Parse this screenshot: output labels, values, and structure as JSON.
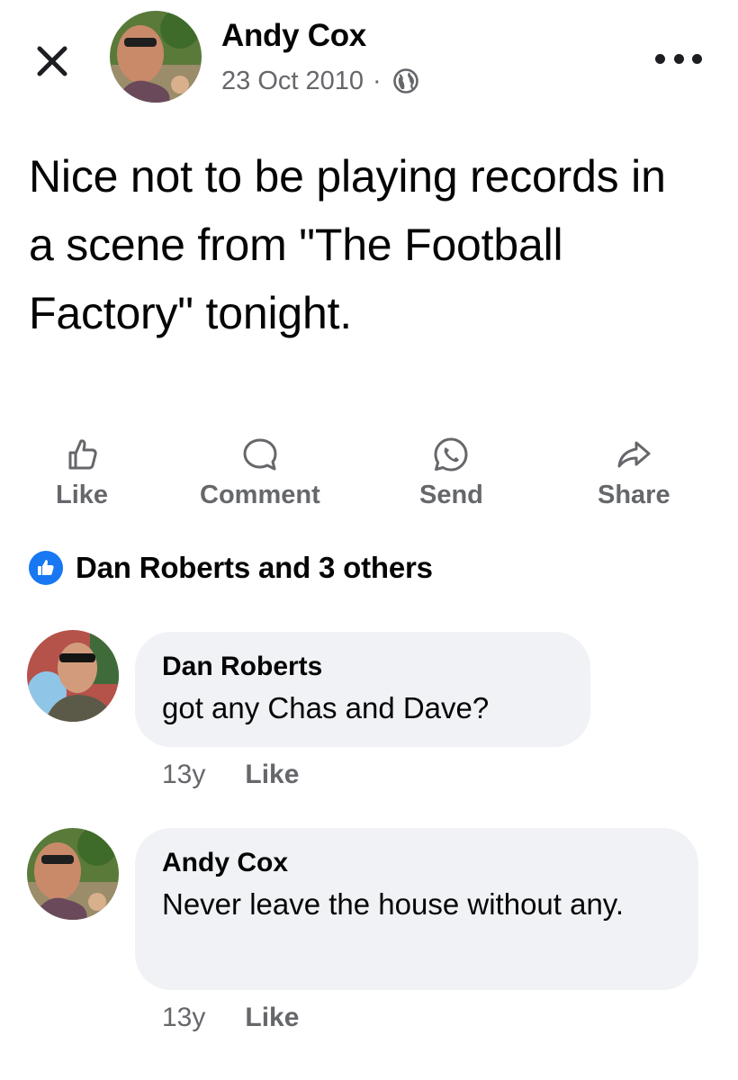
{
  "post": {
    "author": "Andy Cox",
    "date": "23 Oct 2010",
    "separator": "·",
    "audience_icon": "globe-icon",
    "text": "Nice not to be playing records in a scene from \"The Football Factory\" tonight."
  },
  "header": {
    "close_icon": "close-icon",
    "more_icon": "more-options-icon"
  },
  "actions": [
    {
      "label": "Like",
      "icon": "thumbs-up-icon"
    },
    {
      "label": "Comment",
      "icon": "comment-icon"
    },
    {
      "label": "Send",
      "icon": "whatsapp-icon"
    },
    {
      "label": "Share",
      "icon": "share-arrow-icon"
    }
  ],
  "reactions": {
    "icon": "like-badge-icon",
    "text": "Dan Roberts and 3 others"
  },
  "comments": [
    {
      "author": "Dan Roberts",
      "text": "got any Chas and Dave?",
      "time": "13y",
      "like_label": "Like"
    },
    {
      "author": "Andy Cox",
      "text": "Never leave the house without any.",
      "time": "13y",
      "like_label": "Like"
    }
  ],
  "colors": {
    "secondary_text": "#65676b",
    "bubble": "#f0f2f5",
    "brand_blue": "#1877f2"
  }
}
